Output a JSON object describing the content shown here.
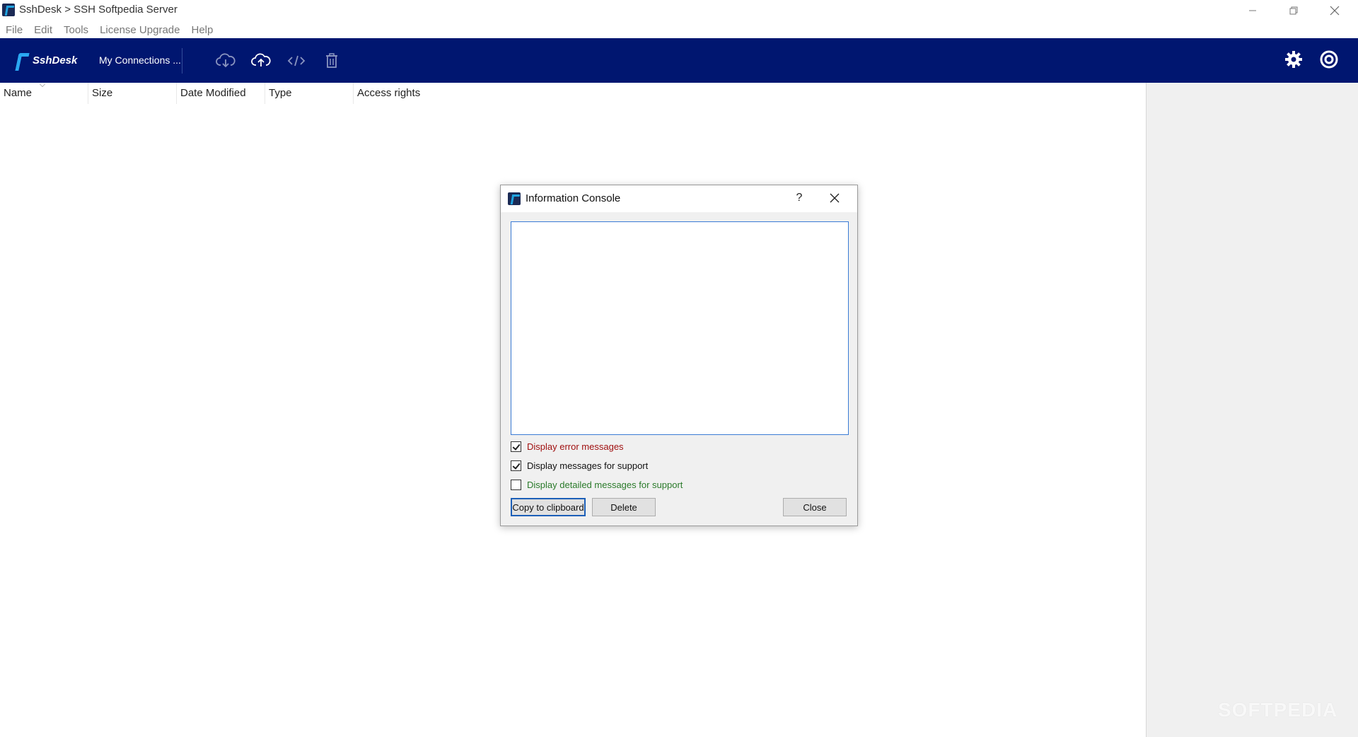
{
  "window": {
    "title": "SshDesk > SSH Softpedia Server",
    "controls": [
      "minimize-icon",
      "restore-icon",
      "close-icon"
    ]
  },
  "menu": {
    "items": [
      {
        "label": "File"
      },
      {
        "label": "Edit"
      },
      {
        "label": "Tools"
      },
      {
        "label": "License Upgrade"
      },
      {
        "label": "Help"
      }
    ]
  },
  "toolbar": {
    "logo_text": "SshDesk",
    "connections_label": "My Connections ...",
    "icons": [
      "cloud-download-icon",
      "cloud-upload-icon",
      "code-icon",
      "trash-icon",
      "gear-icon",
      "power-icon"
    ],
    "background_color": "#001670"
  },
  "file_list": {
    "columns": [
      {
        "label": "Name"
      },
      {
        "label": "Size"
      },
      {
        "label": "Date Modified"
      },
      {
        "label": "Type"
      },
      {
        "label": "Access rights"
      }
    ],
    "rows": []
  },
  "watermark": "SOFTPEDIA",
  "dialog": {
    "title": "Information Console",
    "help_label": "?",
    "console_text": "",
    "options": [
      {
        "label": "Display error messages",
        "checked": true,
        "color": "#a01010"
      },
      {
        "label": "Display messages for support",
        "checked": true,
        "color": "#111111"
      },
      {
        "label": "Display detailed messages for support",
        "checked": false,
        "color": "#2a7a2a"
      }
    ],
    "buttons": {
      "copy": "Copy to clipboard",
      "delete": "Delete",
      "close": "Close"
    }
  }
}
